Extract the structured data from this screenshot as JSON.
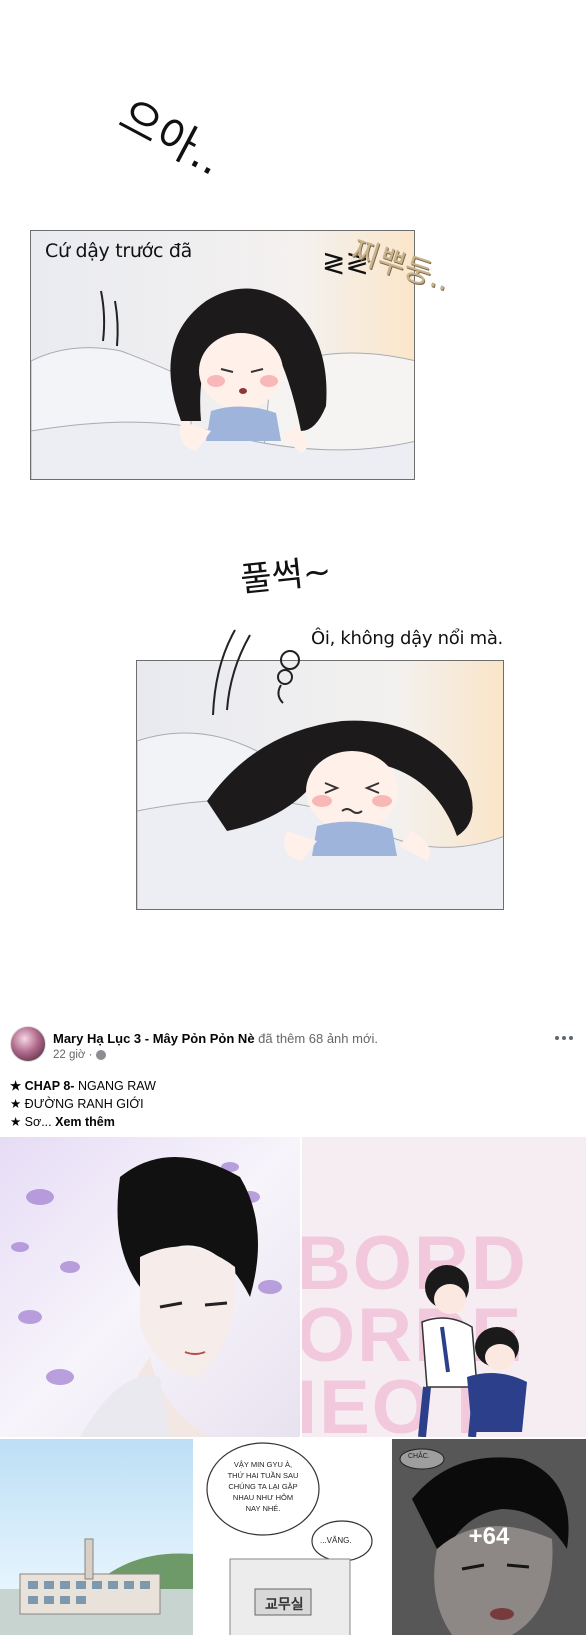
{
  "comic": {
    "sfx_groan": "으아..",
    "sfx_stretch": "찌뿌둥..",
    "sfx_flop": "풀썩~",
    "bubble_1": "Cứ dậy trước đã",
    "bubble_2": "Ôi, không dậy nổi mà."
  },
  "post": {
    "page_name": "Mary Hạ Lục 3 - Mây Pỏn Pỏn Nè",
    "action": "đã thêm 68 ảnh mới.",
    "time": "22 giờ ·",
    "caption": {
      "line1_bold": "★ CHAP 8-",
      "line1_rest": " NGANG RAW",
      "line2": "★ ĐƯỜNG RANH GIỚI",
      "line3": "★ Sơ...",
      "see_more": "Xem thêm"
    },
    "photos": {
      "photo2_title_rows": [
        "BORD",
        "ORDE",
        "IEO I"
      ],
      "photo4_bubble": [
        "VẬY MIN GYU À,",
        "THỨ HAI TUẦN SAU",
        "CHÚNG TA LẠI GẶP",
        "NHAU NHƯ HÔM",
        "NAY NHÉ."
      ],
      "photo4_reply": "...VÂNG.",
      "photo4_sign": "교무실",
      "photo5_bubble": "CHẮC.",
      "more_count": "+64"
    },
    "icons": [
      "globe-icon",
      "more-options-icon"
    ]
  }
}
